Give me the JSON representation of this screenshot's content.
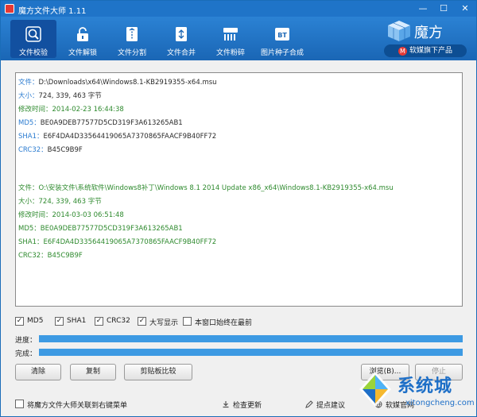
{
  "window": {
    "title": "魔方文件大师 1.11",
    "min_glyph": "—",
    "max_glyph": "☐",
    "close_glyph": "✕"
  },
  "toolbar": {
    "items": [
      {
        "label": "文件校验",
        "icon": "verify-icon",
        "active": true
      },
      {
        "label": "文件解锁",
        "icon": "unlock-icon",
        "active": false
      },
      {
        "label": "文件分割",
        "icon": "split-icon",
        "active": false
      },
      {
        "label": "文件合并",
        "icon": "merge-icon",
        "active": false
      },
      {
        "label": "文件粉碎",
        "icon": "shred-icon",
        "active": false
      },
      {
        "label": "图片种子合成",
        "icon": "bt-icon",
        "active": false
      }
    ],
    "bt_icon_text": "BT"
  },
  "brand": {
    "name": "魔方",
    "sub_badge": "M",
    "sub_text": "软媒旗下产品"
  },
  "results": {
    "entries": [
      {
        "style": "blue",
        "file_key": "文件：",
        "file": "D:\\Downloads\\x64\\Windows8.1-KB2919355-x64.msu",
        "size_key": "大小：",
        "size": "724, 339, 463 字节",
        "mtime_key": "修改时间：",
        "mtime": "2014-02-23 16:44:38",
        "md5_key": "MD5：",
        "md5": "BE0A9DEB77577D5CD319F3A613265AB1",
        "sha1_key": "SHA1：",
        "sha1": "E6F4DA4D33564419065A7370865FAACF9B40FF72",
        "crc_key": "CRC32：",
        "crc": "B45C9B9F"
      },
      {
        "style": "green",
        "file_key": "文件：",
        "file": "O:\\安装文件\\系统软件\\Windows8补丁\\Windows 8.1 2014 Update x86_x64\\Windows8.1-KB2919355-x64.msu",
        "size_key": "大小：",
        "size": "724, 339, 463 字节",
        "mtime_key": "修改时间：",
        "mtime": "2014-03-03 06:51:48",
        "md5_key": "MD5：",
        "md5": "BE0A9DEB77577D5CD319F3A613265AB1",
        "sha1_key": "SHA1：",
        "sha1": "E6F4DA4D33564419065A7370865FAACF9B40FF72",
        "crc_key": "CRC32：",
        "crc": "B45C9B9F"
      }
    ]
  },
  "options": {
    "check_glyph": "✓",
    "md5": "MD5",
    "sha1": "SHA1",
    "crc32": "CRC32",
    "uppercase": "大写显示",
    "always_on_top": "本窗口始终在最前"
  },
  "progress": {
    "progress_label": "进度：",
    "progress_value": 1.0,
    "done_label": "完成：",
    "done_value": 1.0
  },
  "buttons": {
    "clear": "清除",
    "copy": "复制",
    "clipboard_compare": "剪贴板比较",
    "browse": "浏览(B)...",
    "stop": "停止"
  },
  "bottom": {
    "context_menu": "将魔方文件大师关联到右键菜单",
    "check_update": "检查更新",
    "suggest": "提点建议",
    "website": "软媒官网"
  },
  "watermark": {
    "name": "系统城",
    "url": "xitongcheng.com"
  },
  "colors": {
    "titlebar": "#1f74c8",
    "toolbar": "#2b82d4",
    "key_blue": "#2a7bd0",
    "text_green": "#2e8a2e",
    "progress_fill": "#3d9ae3"
  }
}
